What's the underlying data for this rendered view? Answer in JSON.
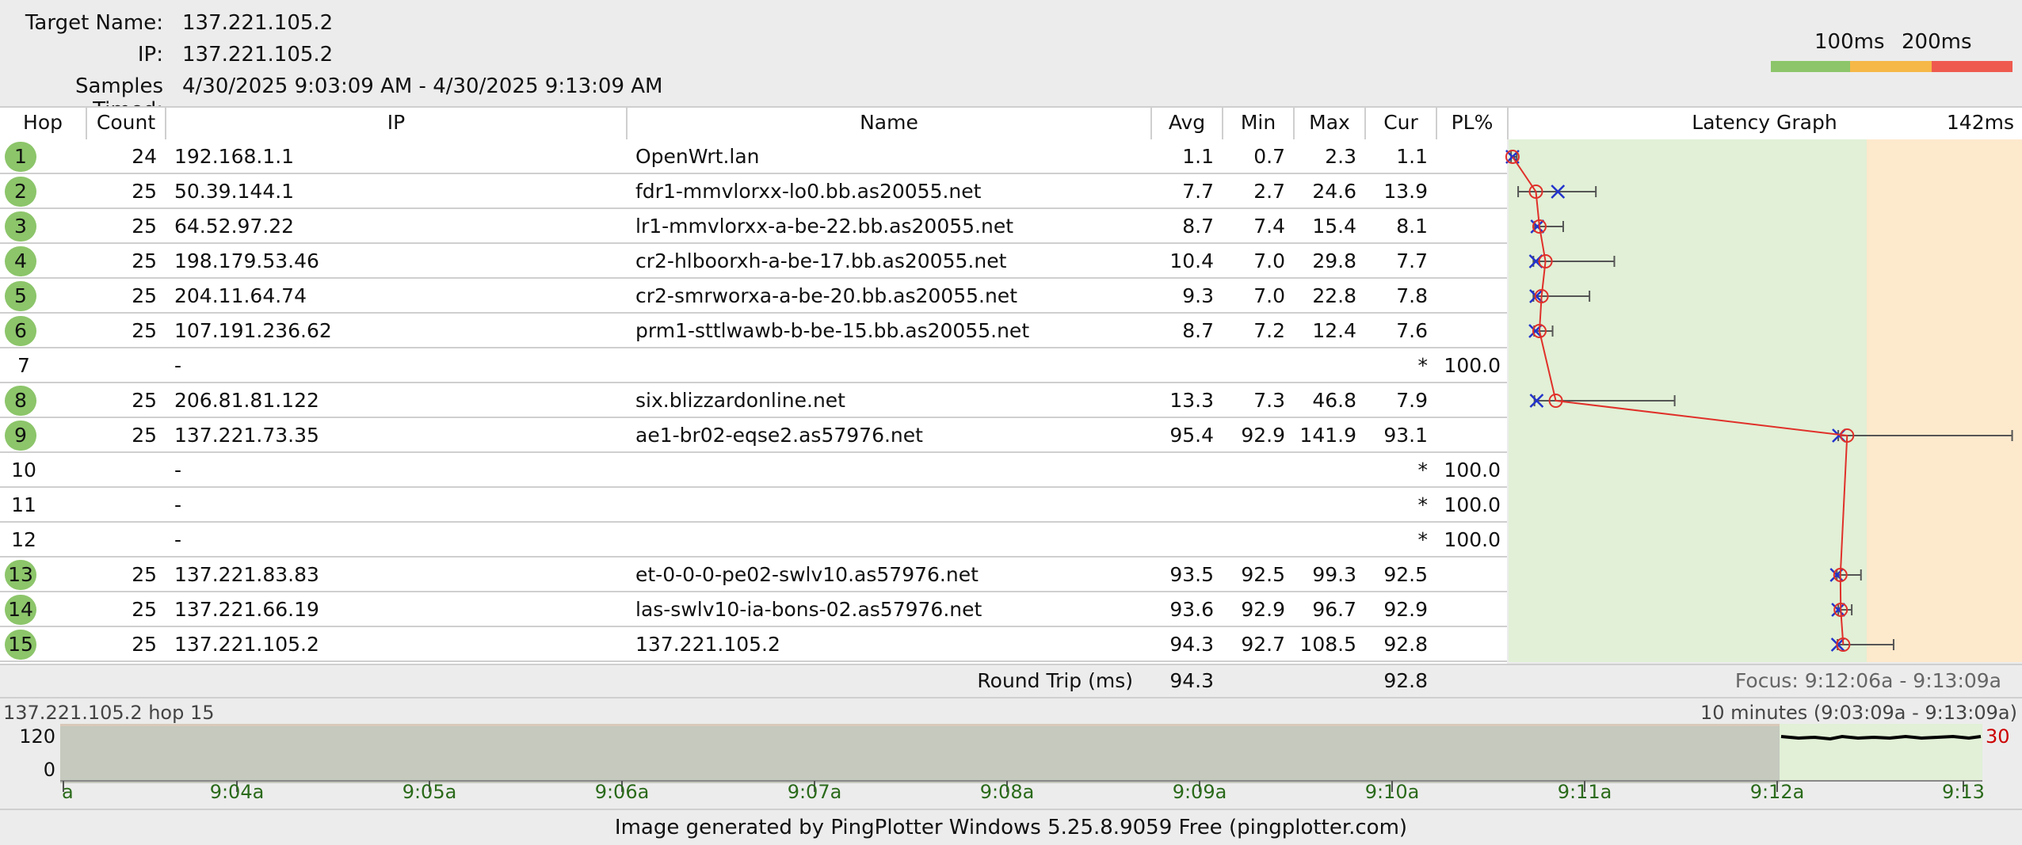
{
  "header": {
    "target_name_label": "Target Name:",
    "target_name_value": "137.221.105.2",
    "ip_label": "IP:",
    "ip_value": "137.221.105.2",
    "samples_label": "Samples Timed:",
    "samples_value": "4/30/2025 9:03:09 AM - 4/30/2025 9:13:09 AM"
  },
  "legend": {
    "label_100": "100ms",
    "label_200": "200ms",
    "colors": [
      "#8cc56a",
      "#f6b846",
      "#ef5a4f"
    ]
  },
  "columns": {
    "hop": "Hop",
    "count": "Count",
    "ip": "IP",
    "name": "Name",
    "avg": "Avg",
    "min": "Min",
    "max": "Max",
    "cur": "Cur",
    "pl": "PL%",
    "graph": "Latency Graph",
    "graph_scale": "142ms"
  },
  "hops": [
    {
      "hop": "1",
      "count": "24",
      "ip": "192.168.1.1",
      "name": "OpenWrt.lan",
      "avg": "1.1",
      "min": "0.7",
      "max": "2.3",
      "cur": "1.1",
      "pl": "",
      "ok": true,
      "avg_v": 1.1,
      "min_v": 0.7,
      "max_v": 2.3,
      "cur_v": 1.1
    },
    {
      "hop": "2",
      "count": "25",
      "ip": "50.39.144.1",
      "name": "fdr1-mmvlorxx-lo0.bb.as20055.net",
      "avg": "7.7",
      "min": "2.7",
      "max": "24.6",
      "cur": "13.9",
      "pl": "",
      "ok": true,
      "avg_v": 7.7,
      "min_v": 2.7,
      "max_v": 24.6,
      "cur_v": 13.9
    },
    {
      "hop": "3",
      "count": "25",
      "ip": "64.52.97.22",
      "name": "lr1-mmvlorxx-a-be-22.bb.as20055.net",
      "avg": "8.7",
      "min": "7.4",
      "max": "15.4",
      "cur": "8.1",
      "pl": "",
      "ok": true,
      "avg_v": 8.7,
      "min_v": 7.4,
      "max_v": 15.4,
      "cur_v": 8.1
    },
    {
      "hop": "4",
      "count": "25",
      "ip": "198.179.53.46",
      "name": "cr2-hlboorxh-a-be-17.bb.as20055.net",
      "avg": "10.4",
      "min": "7.0",
      "max": "29.8",
      "cur": "7.7",
      "pl": "",
      "ok": true,
      "avg_v": 10.4,
      "min_v": 7.0,
      "max_v": 29.8,
      "cur_v": 7.7
    },
    {
      "hop": "5",
      "count": "25",
      "ip": "204.11.64.74",
      "name": "cr2-smrworxa-a-be-20.bb.as20055.net",
      "avg": "9.3",
      "min": "7.0",
      "max": "22.8",
      "cur": "7.8",
      "pl": "",
      "ok": true,
      "avg_v": 9.3,
      "min_v": 7.0,
      "max_v": 22.8,
      "cur_v": 7.8
    },
    {
      "hop": "6",
      "count": "25",
      "ip": "107.191.236.62",
      "name": "prm1-sttlwawb-b-be-15.bb.as20055.net",
      "avg": "8.7",
      "min": "7.2",
      "max": "12.4",
      "cur": "7.6",
      "pl": "",
      "ok": true,
      "avg_v": 8.7,
      "min_v": 7.2,
      "max_v": 12.4,
      "cur_v": 7.6
    },
    {
      "hop": "7",
      "count": "",
      "ip": "-",
      "name": "",
      "avg": "",
      "min": "",
      "max": "",
      "cur": "*",
      "pl": "100.0",
      "ok": false
    },
    {
      "hop": "8",
      "count": "25",
      "ip": "206.81.81.122",
      "name": "six.blizzardonline.net",
      "avg": "13.3",
      "min": "7.3",
      "max": "46.8",
      "cur": "7.9",
      "pl": "",
      "ok": true,
      "avg_v": 13.3,
      "min_v": 7.3,
      "max_v": 46.8,
      "cur_v": 7.9
    },
    {
      "hop": "9",
      "count": "25",
      "ip": "137.221.73.35",
      "name": "ae1-br02-eqse2.as57976.net",
      "avg": "95.4",
      "min": "92.9",
      "max": "141.9",
      "cur": "93.1",
      "pl": "",
      "ok": true,
      "avg_v": 95.4,
      "min_v": 92.9,
      "max_v": 141.9,
      "cur_v": 93.1
    },
    {
      "hop": "10",
      "count": "",
      "ip": "-",
      "name": "",
      "avg": "",
      "min": "",
      "max": "",
      "cur": "*",
      "pl": "100.0",
      "ok": false
    },
    {
      "hop": "11",
      "count": "",
      "ip": "-",
      "name": "",
      "avg": "",
      "min": "",
      "max": "",
      "cur": "*",
      "pl": "100.0",
      "ok": false
    },
    {
      "hop": "12",
      "count": "",
      "ip": "-",
      "name": "",
      "avg": "",
      "min": "",
      "max": "",
      "cur": "*",
      "pl": "100.0",
      "ok": false
    },
    {
      "hop": "13",
      "count": "25",
      "ip": "137.221.83.83",
      "name": "et-0-0-0-pe02-swlv10.as57976.net",
      "avg": "93.5",
      "min": "92.5",
      "max": "99.3",
      "cur": "92.5",
      "pl": "",
      "ok": true,
      "avg_v": 93.5,
      "min_v": 92.5,
      "max_v": 99.3,
      "cur_v": 92.5
    },
    {
      "hop": "14",
      "count": "25",
      "ip": "137.221.66.19",
      "name": "las-swlv10-ia-bons-02.as57976.net",
      "avg": "93.6",
      "min": "92.9",
      "max": "96.7",
      "cur": "92.9",
      "pl": "",
      "ok": true,
      "avg_v": 93.6,
      "min_v": 92.9,
      "max_v": 96.7,
      "cur_v": 92.9
    },
    {
      "hop": "15",
      "count": "25",
      "ip": "137.221.105.2",
      "name": "137.221.105.2",
      "avg": "94.3",
      "min": "92.7",
      "max": "108.5",
      "cur": "92.8",
      "pl": "",
      "ok": true,
      "avg_v": 94.3,
      "min_v": 92.7,
      "max_v": 108.5,
      "cur_v": 92.8
    }
  ],
  "roundtrip": {
    "label": "Round Trip (ms)",
    "avg": "94.3",
    "cur": "92.8",
    "focus": "Focus: 9:12:06a - 9:13:09a"
  },
  "timeline": {
    "target_label": "137.221.105.2 hop 15",
    "range_label": "10 minutes (9:03:09a - 9:13:09a)",
    "y_top": "120",
    "y_bottom": "0",
    "right_value": "30",
    "ticks": [
      "a",
      "9:04a",
      "9:05a",
      "9:06a",
      "9:07a",
      "9:08a",
      "9:09a",
      "9:10a",
      "9:11a",
      "9:12a",
      "9:13"
    ]
  },
  "footer": {
    "text": "Image generated by PingPlotter Windows 5.25.8.9059 Free (pingplotter.com)"
  }
}
